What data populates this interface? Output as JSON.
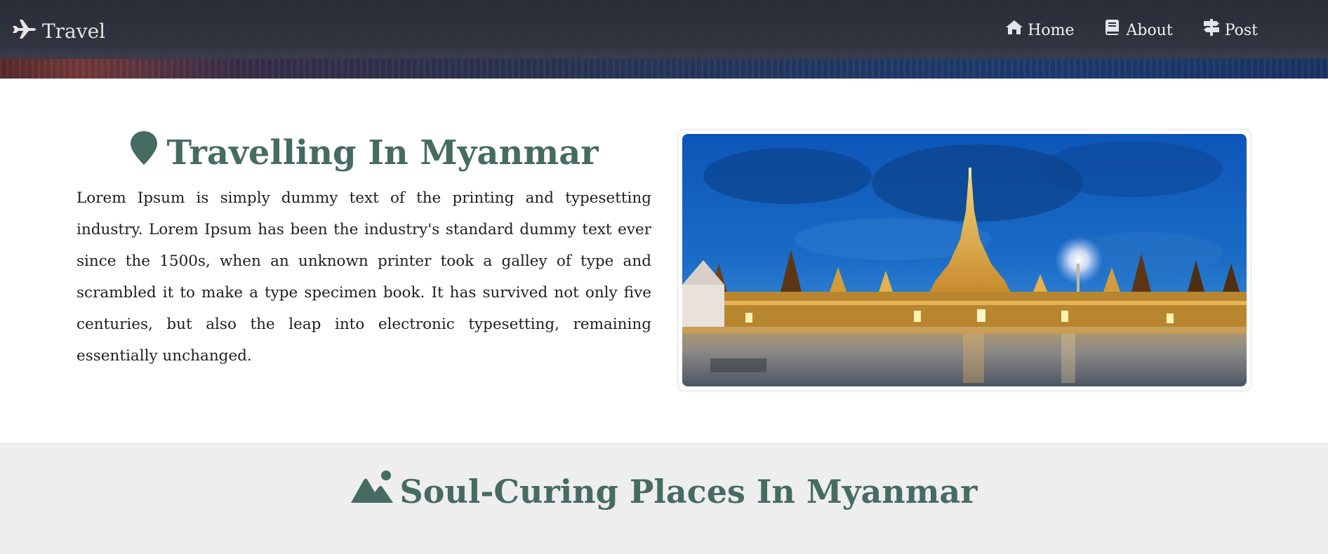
{
  "brand": {
    "label": "Travel",
    "icon": "plane-icon"
  },
  "nav": {
    "items": [
      {
        "label": "Home",
        "icon": "home-icon"
      },
      {
        "label": "About",
        "icon": "book-icon"
      },
      {
        "label": "Post",
        "icon": "signpost-icon"
      }
    ]
  },
  "intro": {
    "title": "Travelling In Myanmar",
    "title_icon": "map-pin-icon",
    "text": "Lorem Ipsum is simply dummy text of the printing and typesetting industry. Lorem Ipsum has been the industry's standard dummy text ever since the 1500s, when an unknown printer took a galley of type and scrambled it to make a type specimen book. It has survived not only five centuries, but also the leap into electronic typesetting, remaining essentially unchanged.",
    "image": "pagoda-photo"
  },
  "places": {
    "title": "Soul-Curing Places In Myanmar",
    "title_icon": "mountain-icon"
  },
  "colors": {
    "accent": "#466b62",
    "header_bg": "#2e313b",
    "section_bg": "#eeeeee"
  }
}
